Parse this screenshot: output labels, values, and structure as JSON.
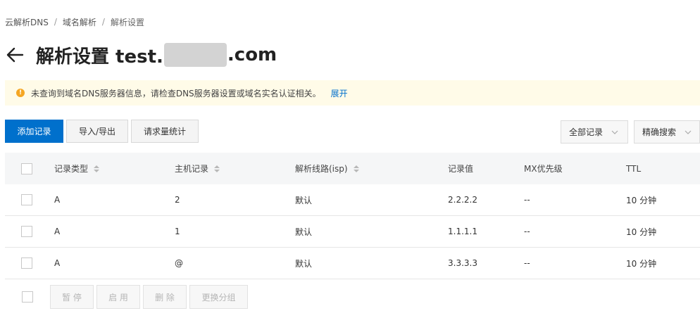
{
  "breadcrumb": {
    "items": [
      "云解析DNS",
      "域名解析",
      "解析设置"
    ],
    "separator": "/"
  },
  "page": {
    "title_prefix": "解析设置 test.",
    "title_suffix": ".com"
  },
  "notice": {
    "text": "未查询到域名DNS服务器信息，请检查DNS服务器设置或域名实名认证相关。",
    "link": "展开",
    "icon": "warning-icon"
  },
  "toolbar": {
    "add": "添加记录",
    "import_export": "导入/导出",
    "stats": "请求量统计",
    "filter_all": "全部记录",
    "search_mode": "精确搜索"
  },
  "table": {
    "headers": {
      "type": "记录类型",
      "host": "主机记录",
      "line": "解析线路(isp)",
      "value": "记录值",
      "mx": "MX优先级",
      "ttl": "TTL"
    },
    "rows": [
      {
        "type": "A",
        "host": "2",
        "line": "默认",
        "value": "2.2.2.2",
        "mx": "--",
        "ttl": "10 分钟"
      },
      {
        "type": "A",
        "host": "1",
        "line": "默认",
        "value": "1.1.1.1",
        "mx": "--",
        "ttl": "10 分钟"
      },
      {
        "type": "A",
        "host": "@",
        "line": "默认",
        "value": "3.3.3.3",
        "mx": "--",
        "ttl": "10 分钟"
      }
    ]
  },
  "batch": {
    "pause": "暂 停",
    "enable": "启 用",
    "delete": "删 除",
    "change_group": "更换分组"
  },
  "colors": {
    "primary": "#0070cc",
    "notice_bg": "#fffbe8",
    "warn": "#f5a623"
  }
}
